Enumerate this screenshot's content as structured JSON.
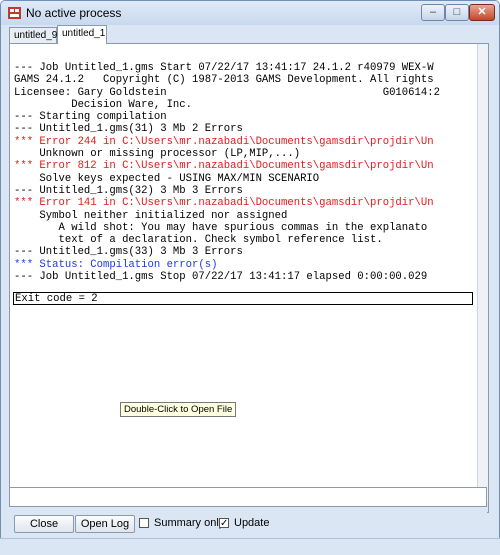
{
  "window": {
    "title": "No active process"
  },
  "tabs": [
    {
      "label": "untitled_9",
      "active": false
    },
    {
      "label": "untitled_1",
      "active": true
    }
  ],
  "log": {
    "lines": [
      {
        "text": "--- Job Untitled_1.gms Start 07/22/17 13:41:17 24.1.2 r40979 WEX-W",
        "color": "black"
      },
      {
        "text": "GAMS 24.1.2   Copyright (C) 1987-2013 GAMS Development. All rights",
        "color": "black"
      },
      {
        "text": "Licensee: Gary Goldstein                                  G010614:2",
        "color": "black"
      },
      {
        "text": "         Decision Ware, Inc.",
        "color": "black"
      },
      {
        "text": "--- Starting compilation",
        "color": "black"
      },
      {
        "text": "--- Untitled_1.gms(31) 3 Mb 2 Errors",
        "color": "black"
      },
      {
        "text": "*** Error 244 in C:\\Users\\mr.nazabadi\\Documents\\gamsdir\\projdir\\Un",
        "color": "red"
      },
      {
        "text": "    Unknown or missing processor (LP,MIP,...)",
        "color": "black"
      },
      {
        "text": "*** Error 812 in C:\\Users\\mr.nazabadi\\Documents\\gamsdir\\projdir\\Un",
        "color": "red"
      },
      {
        "text": "    Solve keys expected - USING MAX/MIN SCENARIO",
        "color": "black"
      },
      {
        "text": "--- Untitled_1.gms(32) 3 Mb 3 Errors",
        "color": "black"
      },
      {
        "text": "*** Error 141 in C:\\Users\\mr.nazabadi\\Documents\\gamsdir\\projdir\\Un",
        "color": "red"
      },
      {
        "text": "    Symbol neither initialized nor assigned",
        "color": "black"
      },
      {
        "text": "       A wild shot: You may have spurious commas in the explanato",
        "color": "black"
      },
      {
        "text": "       text of a declaration. Check symbol reference list.",
        "color": "black"
      },
      {
        "text": "--- Untitled_1.gms(33) 3 Mb 3 Errors",
        "color": "black"
      },
      {
        "text": "*** Status: Compilation error(s)",
        "color": "blue"
      },
      {
        "text": "--- Job Untitled_1.gms Stop 07/22/17 13:41:17 elapsed 0:00:00.029",
        "color": "black"
      }
    ],
    "exit_line": "Exit code = 2"
  },
  "tooltip": "Double-Click to Open File",
  "command_input": {
    "value": ""
  },
  "buttons": {
    "close": "Close",
    "open_log": "Open Log"
  },
  "checkboxes": {
    "summary": {
      "label": "Summary only",
      "checked": false
    },
    "update": {
      "label": "Update",
      "checked": true
    }
  },
  "colors": {
    "error_red": "#e21a1a",
    "status_blue": "#1c3ae0"
  }
}
